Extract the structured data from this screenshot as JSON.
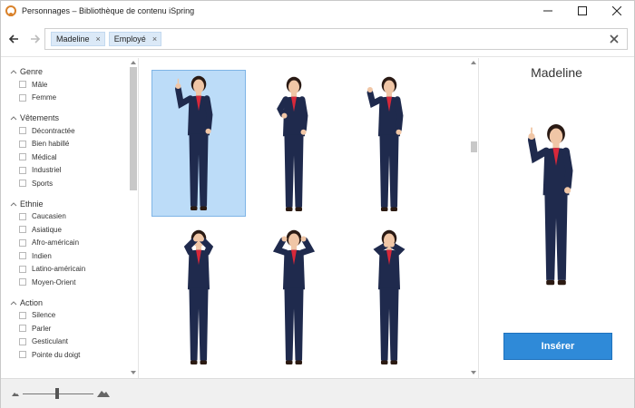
{
  "window": {
    "title": "Personnages – Bibliothèque de contenu iSpring"
  },
  "search": {
    "tags": [
      "Madeline",
      "Employé"
    ],
    "value": "",
    "placeholder": ""
  },
  "filters": [
    {
      "label": "Genre",
      "items": [
        "Mâle",
        "Femme"
      ]
    },
    {
      "label": "Vêtements",
      "items": [
        "Décontractée",
        "Bien habillé",
        "Médical",
        "Industriel",
        "Sports"
      ]
    },
    {
      "label": "Ethnie",
      "items": [
        "Caucasien",
        "Asiatique",
        "Afro-américain",
        "Indien",
        "Latino-américain",
        "Moyen-Orient"
      ]
    },
    {
      "label": "Action",
      "items": [
        "Silence",
        "Parler",
        "Gesticulant",
        "Pointe du doigt"
      ]
    }
  ],
  "grid": {
    "selected_index": 0,
    "poses": [
      "point-up",
      "ok-sign",
      "wave",
      "cover-eyes",
      "cover-ears",
      "cover-mouth"
    ]
  },
  "preview": {
    "name": "Madeline",
    "insert_label": "Insérer"
  },
  "colors": {
    "suit": "#1f2a4d",
    "shirt": "#d8283a",
    "skin": "#f0c6a6",
    "hair": "#2a1a14",
    "selection": "#bcdcf8",
    "accent": "#2f8ad8"
  }
}
